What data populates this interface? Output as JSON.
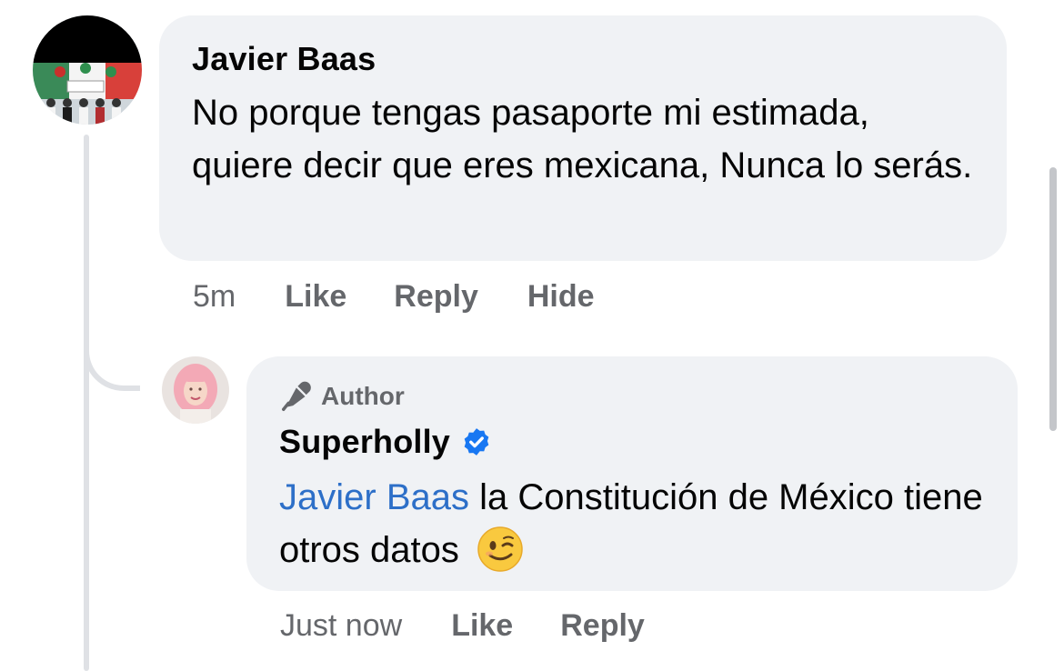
{
  "comments": [
    {
      "author": "Javier Baas",
      "text": "No porque tengas pasaporte mi estimada, quiere decir que eres mexicana, Nunca lo serás.",
      "time": "5m",
      "actions": {
        "like": "Like",
        "reply": "Reply",
        "hide": "Hide"
      }
    }
  ],
  "reply": {
    "badge": "Author",
    "badge_icon": "microphone-icon",
    "author": "Superholly",
    "verified": true,
    "mention": "Javier Baas",
    "text": " la Constitución de México tiene otros datos ",
    "emoji": "winking-face",
    "time": "Just now",
    "actions": {
      "like": "Like",
      "reply": "Reply"
    }
  },
  "colors": {
    "bubble": "#f0f2f5",
    "mention": "#2d6fc8",
    "verified": "#1877f2",
    "muted_text": "#65676b"
  }
}
